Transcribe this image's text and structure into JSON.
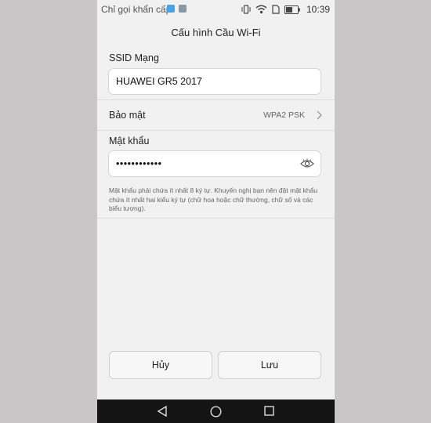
{
  "status_bar": {
    "carrier": "Chỉ gọi khẩn cấp",
    "time": "10:39",
    "icons": [
      "app-notification-icon",
      "gallery-notification-icon",
      "vibrate-icon",
      "wifi-icon",
      "sim-icon",
      "battery-icon"
    ]
  },
  "header": {
    "title": "Cấu hình Cầu Wi-Fi"
  },
  "form": {
    "ssid_label": "SSID Mạng",
    "ssid_value": "HUAWEI GR5 2017",
    "security_label": "Bảo mật",
    "security_value": "WPA2 PSK",
    "password_label": "Mật khẩu",
    "password_value": "••••••••••••",
    "hint": "Mật khẩu phải chứa ít nhất 8 ký tự. Khuyến nghị bạn nên đặt mật khẩu chứa ít nhất hai kiểu ký tự (chữ hoa hoặc chữ thường, chữ số và các biểu tượng)."
  },
  "buttons": {
    "cancel": "Hủy",
    "save": "Lưu"
  },
  "nav": {
    "icons": [
      "back-icon",
      "home-icon",
      "recents-icon"
    ]
  },
  "colors": {
    "background": "#c9c6c7",
    "screen": "#f1f1f1",
    "navbar": "#141414"
  }
}
